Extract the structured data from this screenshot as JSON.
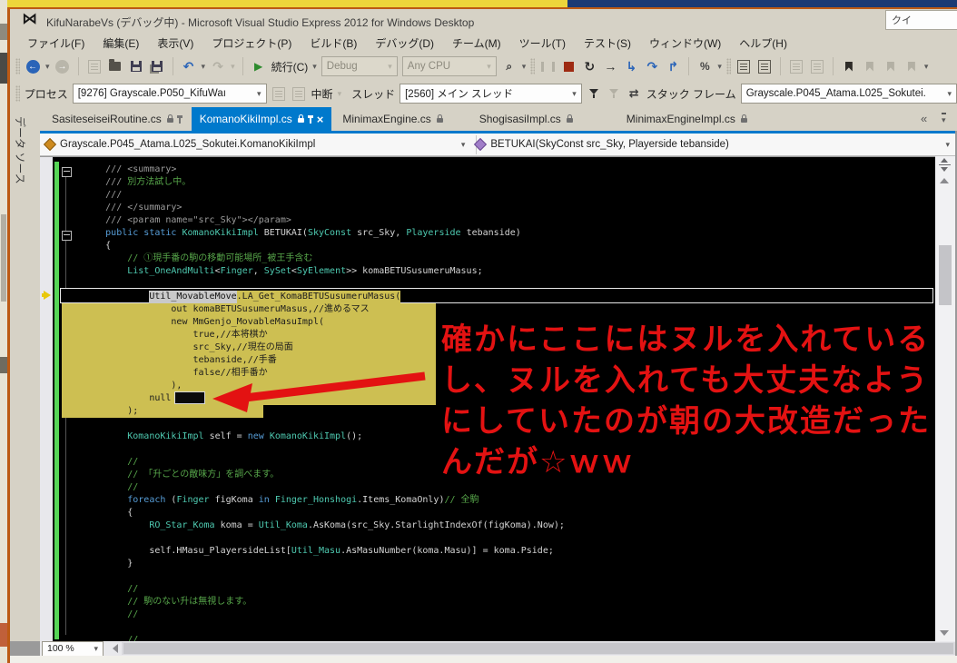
{
  "window": {
    "title": "KifuNarabeVs (デバッグ中) - Microsoft Visual Studio Express 2012 for Windows Desktop",
    "quick_launch": "クイ"
  },
  "menu": {
    "items": [
      "ファイル(F)",
      "編集(E)",
      "表示(V)",
      "プロジェクト(P)",
      "ビルド(B)",
      "デバッグ(D)",
      "チーム(M)",
      "ツール(T)",
      "テスト(S)",
      "ウィンドウ(W)",
      "ヘルプ(H)"
    ]
  },
  "toolbar": {
    "continue_label": "続行(C)",
    "config": "Debug",
    "platform": "Any CPU"
  },
  "debugbar": {
    "process_label": "プロセス",
    "process_value": "[9276] Grayscale.P050_KifuWaı",
    "suspend_label": "中断",
    "thread_label": "スレッド",
    "thread_value": "[2560] メイン スレッド",
    "stack_label": "スタック フレーム",
    "stack_value": "Grayscale.P045_Atama.L025_Sokutei."
  },
  "tabs": {
    "items": [
      {
        "label": "SasiteseiseiRoutine.cs",
        "lock": true,
        "pin": true,
        "active": false,
        "close": false
      },
      {
        "label": "KomanoKikiImpl.cs",
        "lock": true,
        "pin": true,
        "active": true,
        "close": true
      },
      {
        "label": "MinimaxEngine.cs",
        "lock": true,
        "pin": false,
        "active": false,
        "close": false
      },
      {
        "label": "ShogisasiImpl.cs",
        "lock": true,
        "pin": false,
        "active": false,
        "close": false
      },
      {
        "label": "MinimaxEngineImpl.cs",
        "lock": true,
        "pin": false,
        "active": false,
        "close": false
      }
    ]
  },
  "navbar": {
    "type_value": "Grayscale.P045_Atama.L025_Sokutei.KomanoKikiImpl",
    "member_value": "BETUKAI(SkyConst src_Sky, Playerside tebanside)"
  },
  "sidebar": {
    "tab_label": "データ ソース"
  },
  "editor": {
    "lines": [
      {
        "seg": [
          [
            "d",
            "        /// <summary>"
          ]
        ]
      },
      {
        "seg": [
          [
            "d",
            "        /// "
          ],
          [
            "c",
            "別方法試し中。"
          ]
        ]
      },
      {
        "seg": [
          [
            "d",
            "        ///"
          ]
        ]
      },
      {
        "seg": [
          [
            "d",
            "        /// </summary>"
          ]
        ]
      },
      {
        "seg": [
          [
            "d",
            "        /// <param name=\"src_Sky\"></param>"
          ]
        ]
      },
      {
        "seg": [
          [
            "k",
            "        public static "
          ],
          [
            "t",
            "KomanoKikiImpl"
          ],
          [
            "p",
            " BETUKAI("
          ],
          [
            "t",
            "SkyConst"
          ],
          [
            "p",
            " src_Sky, "
          ],
          [
            "t",
            "Playerside"
          ],
          [
            "p",
            " tebanside)"
          ]
        ]
      },
      {
        "seg": [
          [
            "p",
            "        {"
          ]
        ]
      },
      {
        "seg": [
          [
            "c",
            "            // ①現手番の駒の移動可能場所_被王手含む"
          ]
        ]
      },
      {
        "seg": [
          [
            "t",
            "            List_OneAndMulti"
          ],
          [
            "p",
            "<"
          ],
          [
            "t",
            "Finger"
          ],
          [
            "p",
            ", "
          ],
          [
            "t",
            "SySet"
          ],
          [
            "p",
            "<"
          ],
          [
            "t",
            "SyElement"
          ],
          [
            "p",
            ">> komaBETUSusumeruMasus;"
          ]
        ]
      },
      {
        "seg": [
          [
            "p",
            ""
          ]
        ]
      },
      {
        "box": true,
        "seg": [
          [
            "p",
            "                "
          ],
          [
            "s",
            "Util_MovableMove"
          ],
          [
            "y",
            ".LA_Get_KomaBETUSusumeruMasus("
          ]
        ]
      },
      {
        "seg": [
          [
            "y",
            "                    out komaBETUSusumeruMasus,//進めるマス"
          ]
        ]
      },
      {
        "seg": [
          [
            "y",
            "                    new MmGenjo_MovableMasuImpl("
          ]
        ]
      },
      {
        "seg": [
          [
            "y",
            "                        true,//本将棋か"
          ]
        ]
      },
      {
        "seg": [
          [
            "y",
            "                        src_Sky,//現在の局面"
          ]
        ]
      },
      {
        "seg": [
          [
            "y",
            "                        tebanside,//手番"
          ]
        ]
      },
      {
        "seg": [
          [
            "y",
            "                        false//相手番か"
          ]
        ]
      },
      {
        "seg": [
          [
            "y",
            "                    ),"
          ]
        ]
      },
      {
        "seg": [
          [
            "y",
            "                null"
          ]
        ]
      },
      {
        "seg": [
          [
            "y",
            "            );"
          ]
        ]
      },
      {
        "seg": [
          [
            "p",
            ""
          ]
        ]
      },
      {
        "seg": [
          [
            "t",
            "            KomanoKikiImpl"
          ],
          [
            "p",
            " self = "
          ],
          [
            "k",
            "new"
          ],
          [
            "p",
            " "
          ],
          [
            "t",
            "KomanoKikiImpl"
          ],
          [
            "p",
            "();"
          ]
        ]
      },
      {
        "seg": [
          [
            "p",
            ""
          ]
        ]
      },
      {
        "seg": [
          [
            "c",
            "            //"
          ]
        ]
      },
      {
        "seg": [
          [
            "c",
            "            // 「升ごとの敵味方」を調べます。"
          ]
        ]
      },
      {
        "seg": [
          [
            "c",
            "            //"
          ]
        ]
      },
      {
        "seg": [
          [
            "k",
            "            foreach"
          ],
          [
            "p",
            " ("
          ],
          [
            "t",
            "Finger"
          ],
          [
            "p",
            " figKoma "
          ],
          [
            "k",
            "in"
          ],
          [
            "p",
            " "
          ],
          [
            "t",
            "Finger_Honshogi"
          ],
          [
            "p",
            ".Items_KomaOnly)"
          ],
          [
            "c",
            "// 全駒"
          ]
        ]
      },
      {
        "seg": [
          [
            "p",
            "            {"
          ]
        ]
      },
      {
        "seg": [
          [
            "t",
            "                RO_Star_Koma"
          ],
          [
            "p",
            " koma = "
          ],
          [
            "t",
            "Util_Koma"
          ],
          [
            "p",
            ".AsKoma(src_Sky.StarlightIndexOf(figKoma).Now);"
          ]
        ]
      },
      {
        "seg": [
          [
            "p",
            ""
          ]
        ]
      },
      {
        "seg": [
          [
            "p",
            "                self.HMasu_PlayersideList["
          ],
          [
            "t",
            "Util_Masu"
          ],
          [
            "p",
            ".AsMasuNumber(koma.Masu)] = koma.Pside;"
          ]
        ]
      },
      {
        "seg": [
          [
            "p",
            "            }"
          ]
        ]
      },
      {
        "seg": [
          [
            "p",
            ""
          ]
        ]
      },
      {
        "seg": [
          [
            "c",
            "            //"
          ]
        ]
      },
      {
        "seg": [
          [
            "c",
            "            // 駒のない升は無視します。"
          ]
        ]
      },
      {
        "seg": [
          [
            "c",
            "            //"
          ]
        ]
      },
      {
        "seg": [
          [
            "p",
            ""
          ]
        ]
      },
      {
        "seg": [
          [
            "c",
            "            //"
          ]
        ]
      }
    ]
  },
  "annotation": {
    "color": "#e31212",
    "lines": [
      "確かにここにはヌルを入れている",
      "し、ヌルを入れても大丈夫なよう",
      "にしていたのが朝の大改造だった",
      "んだが☆ｗｗ"
    ]
  },
  "statusbar": {
    "zoom": "100 %"
  },
  "colors": {
    "accent_blue": "#007acc",
    "debug_highlight_yellow": "#cdbf52",
    "change_track_green": "#57d657",
    "annotation_red": "#e31212",
    "window_border_orange": "#bc5a14"
  }
}
